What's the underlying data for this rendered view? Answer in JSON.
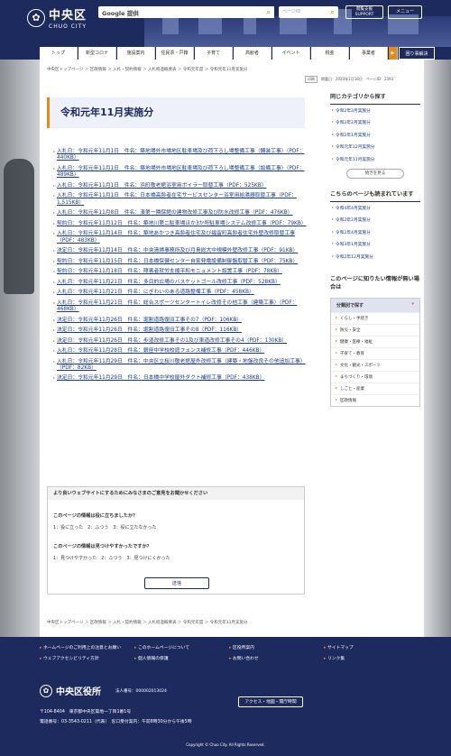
{
  "header": {
    "city": "中央区",
    "city_en": "CHUO CITY",
    "search_label": "Google 提供",
    "pageid_placeholder": "ページID",
    "support": [
      "閲覧支援",
      "SUPPORT"
    ],
    "menu": "メニュー"
  },
  "nav": [
    "トップ",
    "新型コロナ",
    "施設案内",
    "住民票・戸籍",
    "子育て",
    "高齢者",
    "イベント",
    "税金",
    "事業者",
    "▶",
    "困り事解決"
  ],
  "breadcrumb": "中央区トップページ ＞ 区政情報 ＞ 入札・契約情報 ＞ 入札経過概要表 ＞ 令和元年度 ＞ 令和元年11月実施分",
  "print": "印刷",
  "updated": "掲載日：2023年1月18日　ページID：2393",
  "page_title": "令和元年11月実施分",
  "items": [
    "入札日：令和元年11月1日　件名：築地場外市場地区駐車場及び荷下ろし場整備工事（舗装工事）（PDF：440KB）",
    "入札日：令和元年11月1日　件名：築地場外市場地区駐車場及び荷下ろし場整備工事（設備工事）（PDF：489KB）",
    "入札日：令和元年11月1日　件名：浜町敬老館浴室用ボイラー取替工事（PDF：525KB）",
    "入札日：令和元年11月1日　件名：日本橋高齢者在宅サービスセンター浴室用給湯器取替工事（PDF：1,515KB）",
    "入札日：令和元年11月8日　件名：湊第一隣保館の建物改修工事及び防水改修工事（PDF：476KB）",
    "契約日：令和元年11月12日　件名：築地川第二駐車場ほか3か所駐車場システム改修工事（PDF：79KB）",
    "入札日：令和元年11月14日　件名：築地あかつき高齢者住宅及び福留町高齢者住宅外壁改修取替工事（PDF：483KB）",
    "決定日：令和元年11月14日　件名：中央清掃事務所及び月島総大中規模外壁改修工事（PDF：91KB）",
    "契約日：令和元年11月15日　件名：日本橋保健センター自家発電設備制御盤取替工事（PDF：75KB）",
    "契約日：令和元年11月18日　件名：障害者就労支援平和モニュメント設置工事（PDF：78KB）",
    "入札日：令和元年11月21日　件名：多目的広場のバスケットゴール改修工事（PDF：528KB）",
    "入札日：令和元年11月21日　件名：にぎわいのある道路整備工事（PDF：458KB）",
    "入札日：令和元年11月21日　件名：総合スポーツセンタートイレ改修その他工事（建築工事）（PDF：468KB）",
    "決定日：令和元年11月26日　件名：堀割道路復旧工事その7（PDF：106KB）",
    "決定日：令和元年11月26日　件名：堀割道路復旧工事その8（PDF：116KB）",
    "決定日：令和元年11月26日　件名：歩道改修工事その1及び車道改修工事その4（PDF：130KB）",
    "入札日：令和元年11月28日　件名：銀座中学校校庭フェンス補修工事（PDF：446KB）",
    "入札日：令和元年11月29日　件名：中央区立桜川敬老館屋外改修工事（建築・地盤改良その他追加工事）（PDF：82KB）",
    "決定日：令和元年11月29日　件名：日本橋中学校屋外ダクト補修工事（PDF：438KB）"
  ],
  "survey": {
    "header": "より良いウェブサイトにするためにみなさまのご意見をお聞かせください",
    "q1": "このページの情報は役に立ちましたか？",
    "o1": "1：役に立った　2：ふつう　3：役に立たなかった",
    "q2": "このページの情報は見つけやすかったですか？",
    "o2": "1：見つけやすかった　2：ふつう　3：見つけにくかった",
    "submit": "送信"
  },
  "sidebar": {
    "h1": "同じカテゴリから探す",
    "l1": [
      "令和2年3月実施分",
      "令和2年2月実施分",
      "令和2年1月実施分",
      "令和元年12月実施分",
      "令和元年11月実施分"
    ],
    "more": "続きを見る",
    "h2": "こちらのページも読まれています",
    "l2": [
      "令和4年4月実施分",
      "令和2年2月実施分",
      "令和2年4月実施分",
      "令和3年1月実施分",
      "令和2年12月実施分"
    ],
    "h3": "このページに知りたい情報が無い場合は",
    "cat_title": "分類別で探す",
    "cats": [
      "くらし・手続き",
      "防災・安全",
      "健康・医療・福祉",
      "子育て・教育",
      "文化・観光・スポーツ",
      "まちづくり・環境",
      "しごと・産業",
      "区政情報"
    ]
  },
  "footer": {
    "links": [
      "ホームページのご利用上の注意とお願い",
      "このホームページについて",
      "区役所案内",
      "サイトマップ",
      "ウェブアクセシビリティ方針",
      "個人情報の保護",
      "お問い合わせ",
      "リンク集"
    ],
    "name": "中央区役所",
    "corp": "法人番号：000002013024",
    "addr1": "〒104-8404　東京都中央区築地一丁目1番1号",
    "addr2": "電話番号：03-3543-0211（代表）　窓口受付案内：午前8時30分から午後5時",
    "access": "アクセス・地図・開庁時間",
    "copy": "Copyright © Chuo City. All Rights Reserved."
  }
}
